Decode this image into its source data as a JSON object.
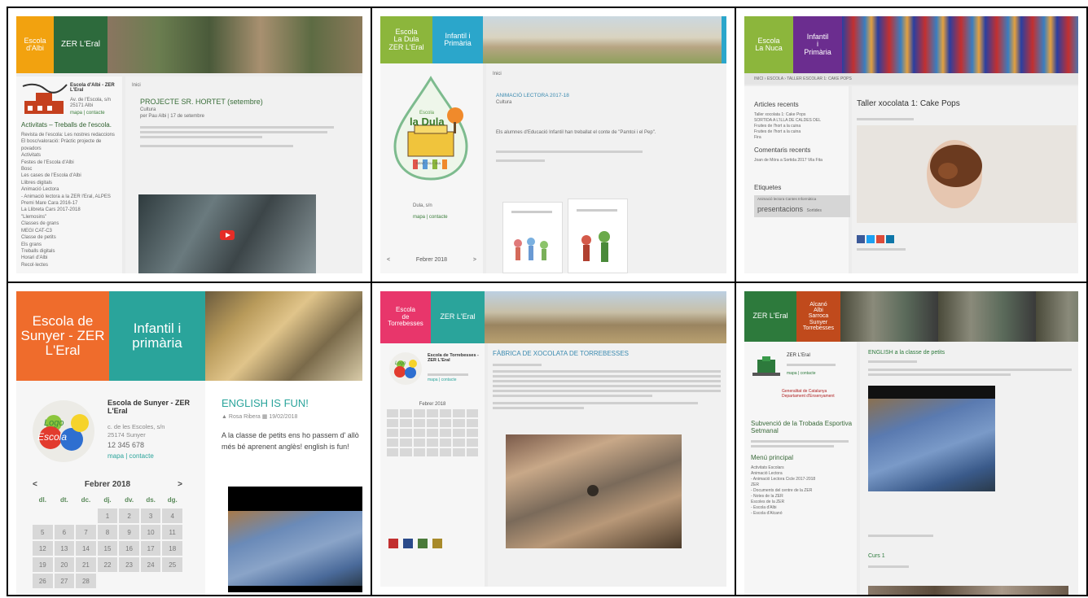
{
  "panels": {
    "p1": {
      "header": {
        "box1": "Escola\nd'Albi",
        "box2": "ZER L'Eral"
      },
      "sidebar": {
        "school_name": "Escola d'Albi - ZER L'Eral",
        "address_lines": [
          "Av. de l'Escola, s/n",
          "25171 Albi"
        ],
        "links": "mapa | contacte",
        "heading": "Activitats – Treballs de l'escola.",
        "menu": [
          "Revista de l'escola: Les nostres redaccions",
          "El bosc/valoració: Pràctic projecte de povadors",
          "Activitats",
          "Festes de l'Escola d'Albi",
          "Bosc",
          "Les cases de l'Escola d'Albi",
          "Llibres digitals",
          "Animació Lectora",
          "- Animació lectora a la ZER l'Eral, ALPES",
          "Premi Mare Cara 2016-17",
          "La Llibreta Cars 2017-2018",
          "\"Llemosins\"",
          "Classes de grans",
          "MEGI CAT-C3",
          "Classe de petits",
          "Els grans",
          "Treballs digitals",
          "Horari d'Albi",
          "Recol·lectes"
        ]
      },
      "content": {
        "breadcrumb": "Inici",
        "post_title": "PROJECTE SR. HORTET (setembre)",
        "post_category": "Cultura",
        "post_meta": "per Pau Albi | 17 de setembre"
      }
    },
    "p2": {
      "header": {
        "box1": "Escola\nLa Dula\nZER L'Eral",
        "box2": "Infantil i\nPrimària"
      },
      "sidebar": {
        "logo_small": "Escola",
        "logo_big": "la Dula",
        "logo_under": "SENT · DU · DIA",
        "address": "Dula, s/n",
        "links": "mapa | contacte",
        "cal_month": "Febrer 2018",
        "cal_prev": "<",
        "cal_next": ">"
      },
      "content": {
        "breadcrumb": "Inici",
        "post_title": "ANIMACIÓ LECTORA 2017-18",
        "post_category": "Cultura",
        "post_text": "Els alumnes d'Educació Infantil han treballat el conte de \"Pamtoi i el Pep\"."
      }
    },
    "p3": {
      "header": {
        "box1": "Escola\nLa Nuca",
        "box2": "Infantil\ni\nPrimària"
      },
      "breadcrumb": "INICI › ESCOLA › TALLER ESCOLAR 1: CAKE POPS",
      "sidebar": {
        "recent_heading": "Articles recents",
        "recent": [
          "Taller xocolata 1: Cake Pops",
          "SORTIDA A L'ILLA DE CALDES DEL",
          "Fruites de l'hort a la cuina",
          "Fruites de l'hort a la cuina",
          "Fira"
        ],
        "comments_heading": "Comentaris recents",
        "comments": [
          "Joan de Móra a Sortida 2017 Vila Fita"
        ],
        "tags_heading": "Etiquetes",
        "tag_small": "Animació lectora Cantes Informàtica",
        "tag_big": "presentacions",
        "tag_after": "Sortides"
      },
      "content": {
        "post_title": "Taller xocolata 1: Cake Pops"
      }
    },
    "p4": {
      "header": {
        "box1": "Escola de\nSunyer - ZER\nL'Eral",
        "box2": "Infantil i\nprimària"
      },
      "logo_top": "Logo",
      "logo_bottom": "Escola",
      "sidebar": {
        "school_name": "Escola de Sunyer - ZER L'Eral",
        "address_line1": "c. de les Escoles, s/n",
        "address_line2": "25174 Sunyer",
        "phone": "12 345 678",
        "links": "mapa  |  contacte"
      },
      "calendar": {
        "prev": "<",
        "month": "Febrer 2018",
        "next": ">",
        "weekdays": [
          "dl.",
          "dt.",
          "dc.",
          "dj.",
          "dv.",
          "ds.",
          "dg."
        ],
        "days": [
          "",
          "",
          "",
          "1",
          "2",
          "3",
          "4",
          "5",
          "6",
          "7",
          "8",
          "9",
          "10",
          "11",
          "12",
          "13",
          "14",
          "15",
          "16",
          "17",
          "18",
          "19",
          "20",
          "21",
          "22",
          "23",
          "24",
          "25",
          "26",
          "27",
          "28"
        ]
      },
      "content": {
        "post_title": "ENGLISH IS FUN!",
        "meta_author": "Rosa Ribera",
        "meta_date": "19/02/2018",
        "post_text": "A la classe de petits ens ho passem d' allò més bé aprenent anglès! english is fun!"
      }
    },
    "p5": {
      "header": {
        "box1": "Escola\nde\nTorrebesses",
        "box2": "ZER L'Eral"
      },
      "logo": "Logo",
      "sidebar": {
        "school_name": "Escola de Torrebesses - ZER L'Eral",
        "links": "mapa | contacte",
        "cal_month": "Febrer 2018"
      },
      "content": {
        "post_title": "FÀBRICA DE XOCOLATA DE TORREBESSES"
      }
    },
    "p6": {
      "header": {
        "box1": "ZER L'Eral",
        "box2": "Alcanó\nAlbi\nSarroca\nSunyer\nTorrebesses"
      },
      "sidebar": {
        "school_name": "ZER L'Eral",
        "links": "mapa | contacte",
        "gencat": "Generalitat de Catalunya\nDepartament d'Ensenyament",
        "heading": "Subvenció de la Trobada Esportiva Setmanal",
        "menu_heading": "Menú principal",
        "menu": [
          "Activitats Escolars",
          "Animació Lectora",
          "- Animació Lectora Cicle 2017-2018",
          "ZER",
          "- Documents del centre de la ZER",
          "- Notes de la ZER",
          "Escoles de la ZER",
          "- Escola d'Albi",
          "- Escola d'Alcanó"
        ]
      },
      "content": {
        "post_title": "ENGLISH a la classe de petits",
        "post2_title": "Curs 1"
      }
    }
  }
}
